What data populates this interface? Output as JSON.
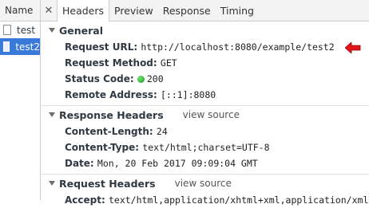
{
  "sidebar": {
    "header": "Name",
    "requests": [
      {
        "name": "test",
        "selected": false
      },
      {
        "name": "test2",
        "selected": true
      }
    ]
  },
  "tabs": {
    "close_glyph": "✕",
    "items": [
      "Headers",
      "Preview",
      "Response",
      "Timing"
    ],
    "active": "Headers"
  },
  "general": {
    "title": "General",
    "request_url_label": "Request URL:",
    "request_url": "http://localhost:8080/example/test2",
    "request_method_label": "Request Method:",
    "request_method": "GET",
    "status_code_label": "Status Code:",
    "status_code": "200",
    "remote_address_label": "Remote Address:",
    "remote_address": "[::1]:8080"
  },
  "response_headers": {
    "title": "Response Headers",
    "view_source": "view source",
    "content_length_label": "Content-Length:",
    "content_length": "24",
    "content_type_label": "Content-Type:",
    "content_type": "text/html;charset=UTF-8",
    "date_label": "Date:",
    "date": "Mon, 20 Feb 2017 09:09:04 GMT"
  },
  "request_headers": {
    "title": "Request Headers",
    "view_source": "view source",
    "accept_label": "Accept:",
    "accept": "text/html,application/xhtml+xml,application/xml;"
  },
  "colors": {
    "selected_row": "#3879d9",
    "status_ok": "#1a9c1a",
    "annotation_arrow": "#e0161b"
  }
}
